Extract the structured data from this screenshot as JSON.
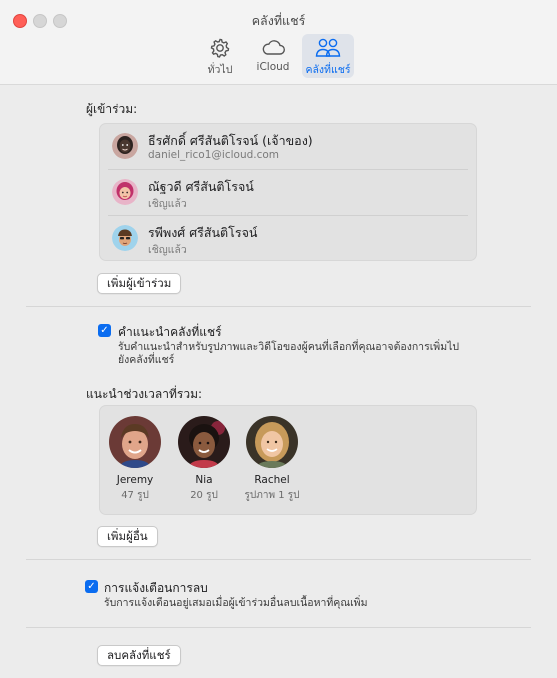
{
  "window": {
    "title": "คลังที่แชร์"
  },
  "toolbar": {
    "tabs": [
      {
        "label": "ทั่วไป",
        "icon": "gear-icon"
      },
      {
        "label": "iCloud",
        "icon": "cloud-icon"
      },
      {
        "label": "คลังที่แชร์",
        "icon": "people-icon",
        "selected": true
      }
    ]
  },
  "participants": {
    "label": "ผู้เข้าร่วม:",
    "rows": [
      {
        "name": "ธีรศักดิ์ ศรีสันติโรจน์ (เจ้าของ)",
        "sub": "daniel_rico1@icloud.com"
      },
      {
        "name": "ณัฐวดี ศรีสันติโรจน์",
        "sub": "เชิญแล้ว"
      },
      {
        "name": "รพีพงศ์ ศรีสันติโรจน์",
        "sub": "เชิญแล้ว"
      }
    ],
    "add_button": "เพิ่มผู้เข้าร่วม"
  },
  "suggestions": {
    "title": "คำแนะนำคลังที่แชร์",
    "checked": true,
    "desc_line1": "รับคำแนะนำสำหรับรูปภาพและวิดีโอของผู้คนที่เลือกที่คุณอาจต้องการเพิ่มไป",
    "desc_line2": "ยังคลังที่แชร์"
  },
  "suggest_period": {
    "label": "แนะนำช่วงเวลาที่รวม:",
    "people": [
      {
        "name": "Jeremy",
        "count": "47 รูป"
      },
      {
        "name": "Nia",
        "count": "20 รูป"
      },
      {
        "name": "Rachel",
        "count": "รูปภาพ 1 รูป"
      }
    ],
    "add_button": "เพิ่มผู้อื่น"
  },
  "deletion_alert": {
    "title": "การแจ้งเตือนการลบ",
    "checked": true,
    "desc": "รับการแจ้งเตือนอยู่เสมอเมื่อผู้เข้าร่วมอื่นลบเนื้อหาที่คุณเพิ่ม"
  },
  "delete_button": "ลบคลังที่แชร์",
  "colors": {
    "accent": "#0a6cf0",
    "close": "#ff5f57"
  }
}
